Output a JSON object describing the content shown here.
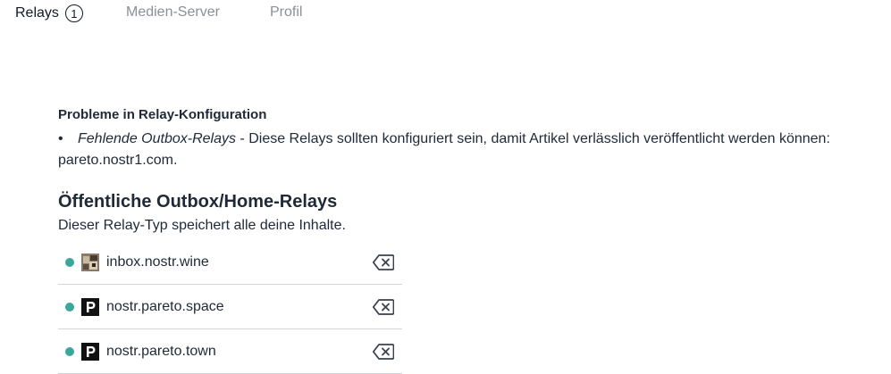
{
  "tabs": [
    {
      "label": "Relays",
      "badge": "1",
      "active": true
    },
    {
      "label": "Medien-Server",
      "active": false
    },
    {
      "label": "Profil",
      "active": false
    }
  ],
  "problems": {
    "title": "Probleme in Relay-Konfiguration",
    "items": [
      {
        "bullet": "•",
        "emphasis": "Fehlende Outbox-Relays",
        "text": " - Diese Relays sollten konfiguriert sein, damit Artikel verlässlich veröffentlicht werden können: pareto.nostr1.com."
      }
    ]
  },
  "section": {
    "title": "Öffentliche Outbox/Home-Relays",
    "description": "Dieser Relay-Typ speichert alle deine Inhalte."
  },
  "relays": [
    {
      "name": "inbox.nostr.wine",
      "icon": "wine-relay-icon",
      "status_color": "#3aa79a"
    },
    {
      "name": "nostr.pareto.space",
      "icon": "pareto-p-icon",
      "status_color": "#3aa79a"
    },
    {
      "name": "nostr.pareto.town",
      "icon": "pareto-p-icon",
      "status_color": "#3aa79a"
    }
  ]
}
